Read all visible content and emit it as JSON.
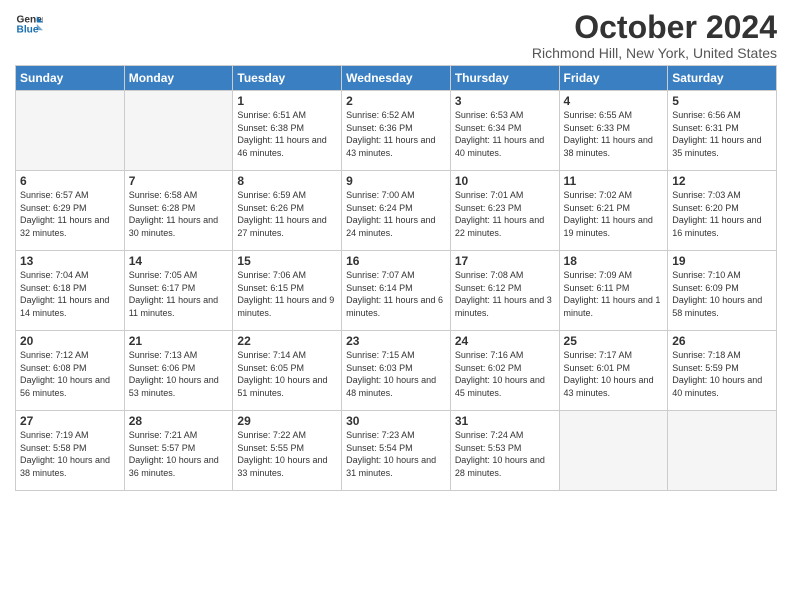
{
  "logo": {
    "line1": "General",
    "line2": "Blue"
  },
  "title": "October 2024",
  "location": "Richmond Hill, New York, United States",
  "weekdays": [
    "Sunday",
    "Monday",
    "Tuesday",
    "Wednesday",
    "Thursday",
    "Friday",
    "Saturday"
  ],
  "weeks": [
    [
      {
        "day": "",
        "empty": true
      },
      {
        "day": "",
        "empty": true
      },
      {
        "day": "1",
        "sunrise": "6:51 AM",
        "sunset": "6:38 PM",
        "daylight": "11 hours and 46 minutes."
      },
      {
        "day": "2",
        "sunrise": "6:52 AM",
        "sunset": "6:36 PM",
        "daylight": "11 hours and 43 minutes."
      },
      {
        "day": "3",
        "sunrise": "6:53 AM",
        "sunset": "6:34 PM",
        "daylight": "11 hours and 40 minutes."
      },
      {
        "day": "4",
        "sunrise": "6:55 AM",
        "sunset": "6:33 PM",
        "daylight": "11 hours and 38 minutes."
      },
      {
        "day": "5",
        "sunrise": "6:56 AM",
        "sunset": "6:31 PM",
        "daylight": "11 hours and 35 minutes."
      }
    ],
    [
      {
        "day": "6",
        "sunrise": "6:57 AM",
        "sunset": "6:29 PM",
        "daylight": "11 hours and 32 minutes."
      },
      {
        "day": "7",
        "sunrise": "6:58 AM",
        "sunset": "6:28 PM",
        "daylight": "11 hours and 30 minutes."
      },
      {
        "day": "8",
        "sunrise": "6:59 AM",
        "sunset": "6:26 PM",
        "daylight": "11 hours and 27 minutes."
      },
      {
        "day": "9",
        "sunrise": "7:00 AM",
        "sunset": "6:24 PM",
        "daylight": "11 hours and 24 minutes."
      },
      {
        "day": "10",
        "sunrise": "7:01 AM",
        "sunset": "6:23 PM",
        "daylight": "11 hours and 22 minutes."
      },
      {
        "day": "11",
        "sunrise": "7:02 AM",
        "sunset": "6:21 PM",
        "daylight": "11 hours and 19 minutes."
      },
      {
        "day": "12",
        "sunrise": "7:03 AM",
        "sunset": "6:20 PM",
        "daylight": "11 hours and 16 minutes."
      }
    ],
    [
      {
        "day": "13",
        "sunrise": "7:04 AM",
        "sunset": "6:18 PM",
        "daylight": "11 hours and 14 minutes."
      },
      {
        "day": "14",
        "sunrise": "7:05 AM",
        "sunset": "6:17 PM",
        "daylight": "11 hours and 11 minutes."
      },
      {
        "day": "15",
        "sunrise": "7:06 AM",
        "sunset": "6:15 PM",
        "daylight": "11 hours and 9 minutes."
      },
      {
        "day": "16",
        "sunrise": "7:07 AM",
        "sunset": "6:14 PM",
        "daylight": "11 hours and 6 minutes."
      },
      {
        "day": "17",
        "sunrise": "7:08 AM",
        "sunset": "6:12 PM",
        "daylight": "11 hours and 3 minutes."
      },
      {
        "day": "18",
        "sunrise": "7:09 AM",
        "sunset": "6:11 PM",
        "daylight": "11 hours and 1 minute."
      },
      {
        "day": "19",
        "sunrise": "7:10 AM",
        "sunset": "6:09 PM",
        "daylight": "10 hours and 58 minutes."
      }
    ],
    [
      {
        "day": "20",
        "sunrise": "7:12 AM",
        "sunset": "6:08 PM",
        "daylight": "10 hours and 56 minutes."
      },
      {
        "day": "21",
        "sunrise": "7:13 AM",
        "sunset": "6:06 PM",
        "daylight": "10 hours and 53 minutes."
      },
      {
        "day": "22",
        "sunrise": "7:14 AM",
        "sunset": "6:05 PM",
        "daylight": "10 hours and 51 minutes."
      },
      {
        "day": "23",
        "sunrise": "7:15 AM",
        "sunset": "6:03 PM",
        "daylight": "10 hours and 48 minutes."
      },
      {
        "day": "24",
        "sunrise": "7:16 AM",
        "sunset": "6:02 PM",
        "daylight": "10 hours and 45 minutes."
      },
      {
        "day": "25",
        "sunrise": "7:17 AM",
        "sunset": "6:01 PM",
        "daylight": "10 hours and 43 minutes."
      },
      {
        "day": "26",
        "sunrise": "7:18 AM",
        "sunset": "5:59 PM",
        "daylight": "10 hours and 40 minutes."
      }
    ],
    [
      {
        "day": "27",
        "sunrise": "7:19 AM",
        "sunset": "5:58 PM",
        "daylight": "10 hours and 38 minutes."
      },
      {
        "day": "28",
        "sunrise": "7:21 AM",
        "sunset": "5:57 PM",
        "daylight": "10 hours and 36 minutes."
      },
      {
        "day": "29",
        "sunrise": "7:22 AM",
        "sunset": "5:55 PM",
        "daylight": "10 hours and 33 minutes."
      },
      {
        "day": "30",
        "sunrise": "7:23 AM",
        "sunset": "5:54 PM",
        "daylight": "10 hours and 31 minutes."
      },
      {
        "day": "31",
        "sunrise": "7:24 AM",
        "sunset": "5:53 PM",
        "daylight": "10 hours and 28 minutes."
      },
      {
        "day": "",
        "empty": true
      },
      {
        "day": "",
        "empty": true
      }
    ]
  ]
}
